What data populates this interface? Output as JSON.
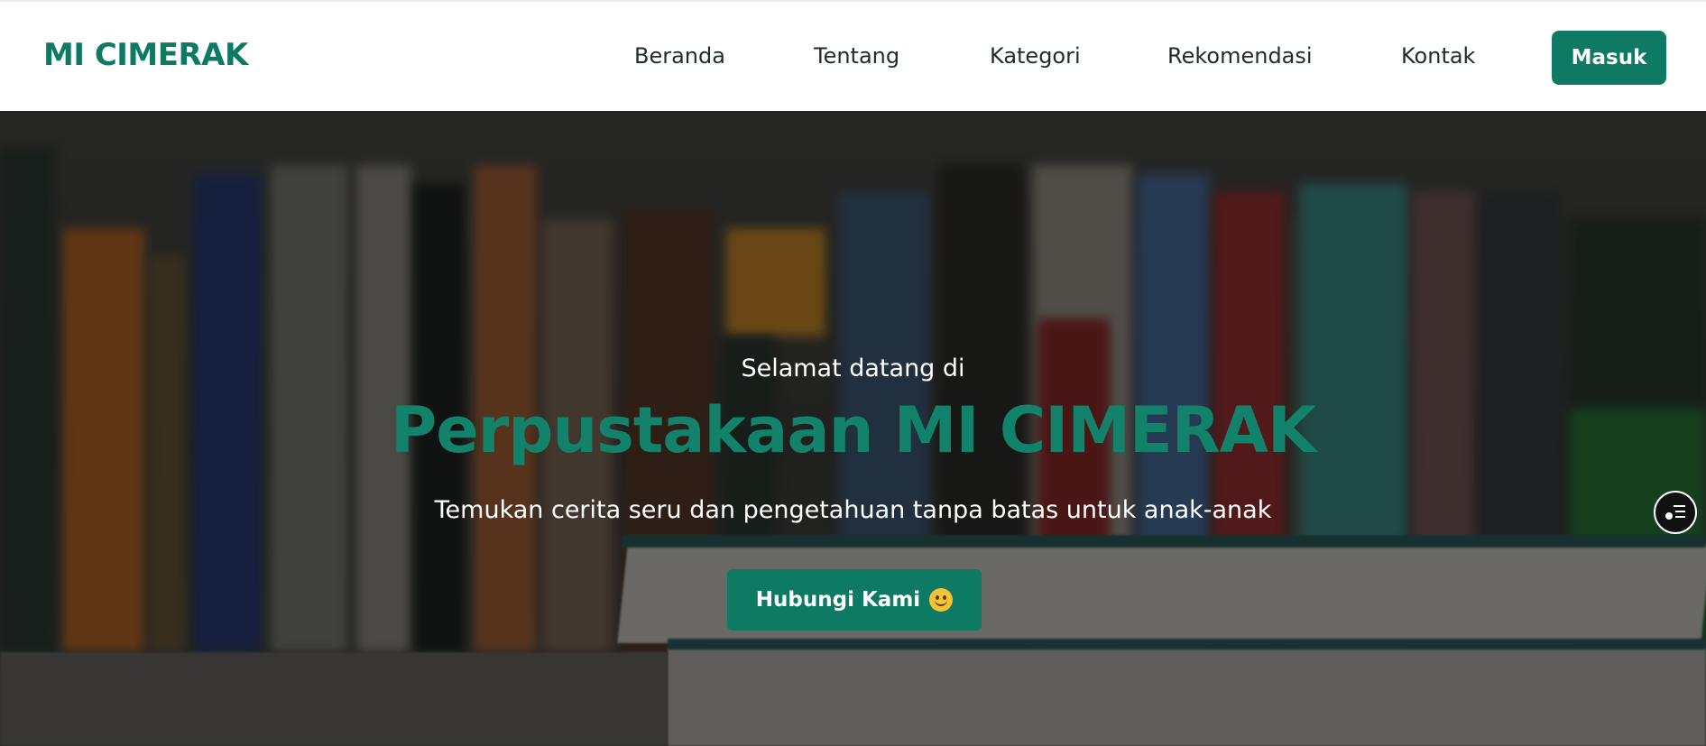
{
  "header": {
    "brand": "MI CIMERAK",
    "nav": [
      {
        "label": "Beranda"
      },
      {
        "label": "Tentang"
      },
      {
        "label": "Kategori"
      },
      {
        "label": "Rekomendasi"
      },
      {
        "label": "Kontak"
      }
    ],
    "login_label": "Masuk"
  },
  "hero": {
    "greeting": "Selamat datang di",
    "title": "Perpustakaan MI CIMERAK",
    "subtitle": "Temukan cerita seru dan pengetahuan tanpa batas untuk anak-anak",
    "cta_label": "Hubungi Kami",
    "cta_icon": "smile-emoji-icon",
    "floating_icon": "toc-menu-icon"
  },
  "colors": {
    "accent": "#0f7a63",
    "title": "#12826a",
    "nav_text": "#1f2d2a"
  }
}
